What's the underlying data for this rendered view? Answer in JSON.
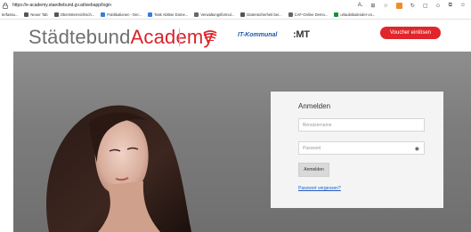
{
  "browser": {
    "url": "https://e-academy.staedtebund.gv.at/webapp/login",
    "toolbar_icons": [
      "read-aloud-icon",
      "immersive-reader-icon",
      "favorite-star-icon",
      "extension-icon",
      "refresh-icon",
      "split-screen-icon",
      "favorites-icon",
      "collections-icon"
    ]
  },
  "bookmarks": [
    {
      "label": "terfassu...",
      "icon": "tab-icon",
      "color": "#ffffff"
    },
    {
      "label": "Neuer Tab",
      "icon": "tab-icon",
      "color": "#555555"
    },
    {
      "label": "Oberösterreichisch...",
      "icon": "folder-icon",
      "color": "#555555"
    },
    {
      "label": "Publikationen - Der...",
      "icon": "document-icon",
      "color": "#3a7bd5"
    },
    {
      "label": "Task Ablöse Dome...",
      "icon": "flag-icon",
      "color": "#3b7be0"
    },
    {
      "label": "Verwaltungsformul...",
      "icon": "page-icon",
      "color": "#666666"
    },
    {
      "label": "Datensicherheit bei...",
      "icon": "globe-icon",
      "color": "#555555"
    },
    {
      "label": "CAF-Online Demo...",
      "icon": "page-icon",
      "color": "#666666"
    },
    {
      "label": "urlaubskalender-vo...",
      "icon": "app-icon",
      "color": "#1a8f3c"
    }
  ],
  "header": {
    "brand_part1": "Städtebund",
    "brand_part2": "Academy",
    "logo_itk": "IT-Kommunal",
    "logo_mt": ":MT",
    "voucher_label": "Voucher einlösen"
  },
  "login": {
    "title": "Anmelden",
    "username_placeholder": "Benutzername",
    "password_placeholder": "Passwort",
    "submit_label": "Anmelden",
    "forgot_label": "Passwort vergessen?"
  },
  "colors": {
    "brand_red": "#d8232a",
    "brand_grey": "#6f6f6f",
    "button_red": "#e0262b",
    "link_blue": "#1f5cc4"
  }
}
